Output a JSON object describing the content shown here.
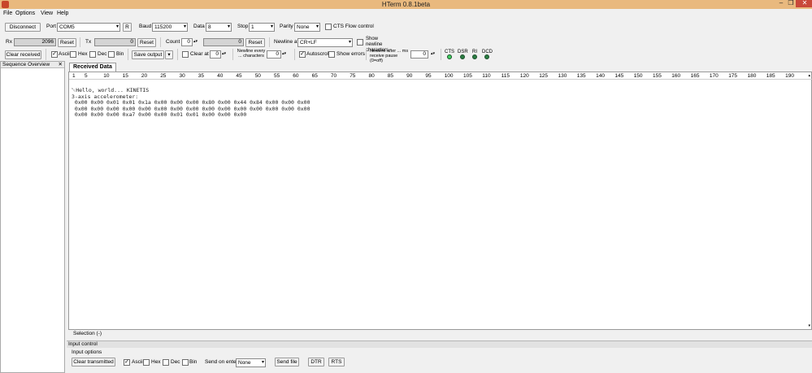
{
  "window": {
    "title": "HTerm 0.8.1beta",
    "minimize": "–",
    "maximize": "❐",
    "close": "✕"
  },
  "menu": [
    "File",
    "Options",
    "View",
    "Help"
  ],
  "toolbar1": {
    "disconnect": "Disconnect",
    "port_label": "Port",
    "port_value": "COM5",
    "rescan": "R",
    "baud_label": "Baud",
    "baud_value": "115200",
    "data_label": "Data",
    "data_value": "8",
    "stop_label": "Stop",
    "stop_value": "1",
    "parity_label": "Parity",
    "parity_value": "None",
    "cts_flow": "CTS Flow control"
  },
  "toolbar2": {
    "rx_label": "Rx",
    "rx_value": "2096",
    "rx_reset": "Reset",
    "tx_label": "Tx",
    "tx_value": "0",
    "tx_reset": "Reset",
    "count_label": "Count",
    "count_value": "0",
    "count_field": "0",
    "count_reset": "Reset",
    "newline_at_label": "Newline at",
    "newline_at_value": "CR+LF",
    "show_newline": "Show newline characters"
  },
  "toolbar3": {
    "clear_received": "Clear received",
    "ascii": "Ascii",
    "hex": "Hex",
    "dec": "Dec",
    "bin": "Bin",
    "save_output": "Save output",
    "clear_at": "Clear at",
    "clear_at_value": "0",
    "newline_every": "Newline every ... characters",
    "newline_every_value": "0",
    "autoscroll": "Autoscroll",
    "show_errors": "Show errors",
    "newline_after": "Newline after ... ms receive pause (0=off)",
    "newline_after_value": "0",
    "cts": "CTS",
    "dsr": "DSR",
    "ri": "RI",
    "dcd": "DCD"
  },
  "sequence_overview": {
    "title": "Sequence Overview",
    "close": "✕"
  },
  "received_tab": "Received Data",
  "ruler": [
    "1",
    "5",
    "10",
    "15",
    "20",
    "25",
    "30",
    "35",
    "40",
    "45",
    "50",
    "55",
    "60",
    "65",
    "70",
    "75",
    "80",
    "85",
    "90",
    "95",
    "100",
    "105",
    "110",
    "115",
    "120",
    "125",
    "130",
    "135",
    "140",
    "145",
    "150",
    "155",
    "160",
    "165",
    "170",
    "175",
    "180",
    "185",
    "190"
  ],
  "received_lines": [
    "␀Hello, world... KINETIS",
    "3-axis accelerometer:",
    " 0x00 0x00 0x01 0x01 0x1a 0x00 0x00 0x00 0x80 0x00 0x44 0x84 0x00 0x00 0x00",
    " 0x00 0x00 0x00 0x00 0x00 0x00 0x00 0x00 0x00 0x00 0x00 0x00 0x00 0x00 0x00",
    " 0x00 0x00 0x00 0xa7 0x00 0x00 0x01 0x01 0x00 0x00 0x00"
  ],
  "selection_status": "Selection (-)",
  "input_control": {
    "title": "Input control",
    "options_label": "Input options",
    "clear_transmitted": "Clear transmitted",
    "ascii": "Ascii",
    "hex": "Hex",
    "dec": "Dec",
    "bin": "Bin",
    "send_on_enter": "Send on enter",
    "send_on_enter_value": "None",
    "send_file": "Send file",
    "dtr": "DTR",
    "rts": "RTS"
  }
}
